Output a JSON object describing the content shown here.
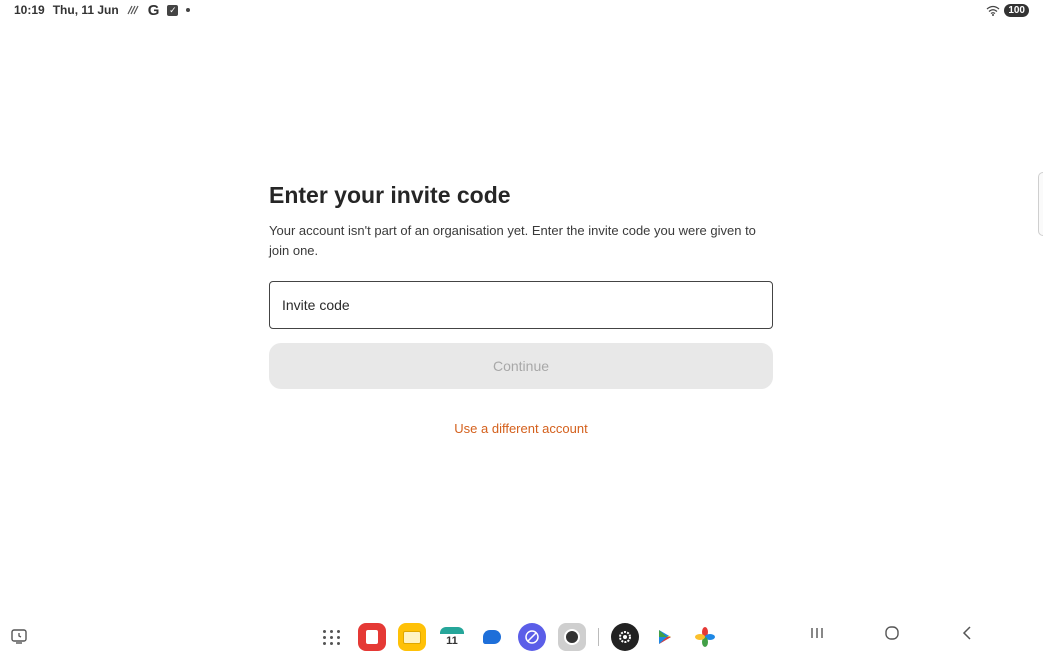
{
  "status_bar": {
    "time": "10:19",
    "date": "Thu, 11 Jun",
    "battery": "100"
  },
  "invite": {
    "title": "Enter your invite code",
    "description": "Your account isn't part of an organisation yet. Enter the invite code you were given to join one.",
    "input_placeholder": "Invite code",
    "input_value": "",
    "continue_label": "Continue",
    "alt_account_label": "Use a different account"
  },
  "taskbar": {
    "calendar_day": "11",
    "apps": [
      "app-drawer-icon",
      "notes-app-icon",
      "files-app-icon",
      "calendar-app-icon",
      "messages-app-icon",
      "browser-app-icon",
      "camera-app-icon",
      "settings-app-icon",
      "play-store-icon",
      "photos-app-icon"
    ],
    "nav": [
      "recents-icon",
      "home-icon",
      "back-icon"
    ]
  },
  "colors": {
    "accent_link": "#d4601c",
    "button_disabled_bg": "#e8e8e8",
    "button_disabled_text": "#a8a8a8"
  }
}
